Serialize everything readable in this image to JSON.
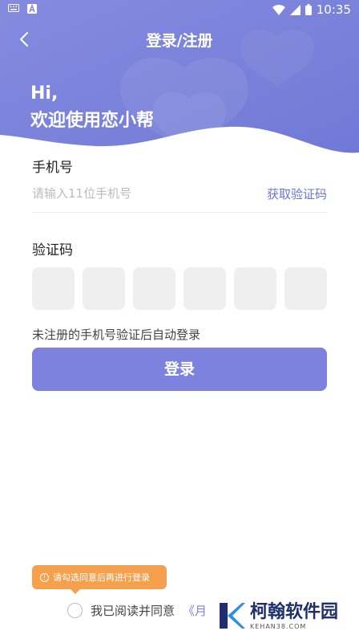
{
  "status_bar": {
    "time": "10:35",
    "icons": [
      "keyboard-icon",
      "notification-a-icon",
      "wifi-icon",
      "signal-icon",
      "battery-icon"
    ]
  },
  "nav": {
    "back_icon": "chevron-left-icon",
    "title": "登录/注册"
  },
  "greeting": {
    "line1": "Hi,",
    "line2": "欢迎使用恋小帮"
  },
  "phone": {
    "label": "手机号",
    "placeholder": "请输入11位手机号",
    "value": "",
    "get_code_label": "获取验证码"
  },
  "code": {
    "label": "验证码",
    "digits": [
      "",
      "",
      "",
      "",
      "",
      ""
    ]
  },
  "hint": "未注册的手机号验证后自动登录",
  "login_button": "登录",
  "tooltip": {
    "icon": "info-icon",
    "text": "请勾选同意后再进行登录"
  },
  "agreement": {
    "checked": false,
    "text": "我已阅读并同意",
    "link_fragment": "《月"
  },
  "watermark": {
    "main": "柯翰软件园",
    "sub": "KEHAN38.COM"
  },
  "colors": {
    "primary": "#7c82dd",
    "hero": "#7b83dc",
    "tooltip": "#f5a04d",
    "link": "#6a75d8"
  }
}
